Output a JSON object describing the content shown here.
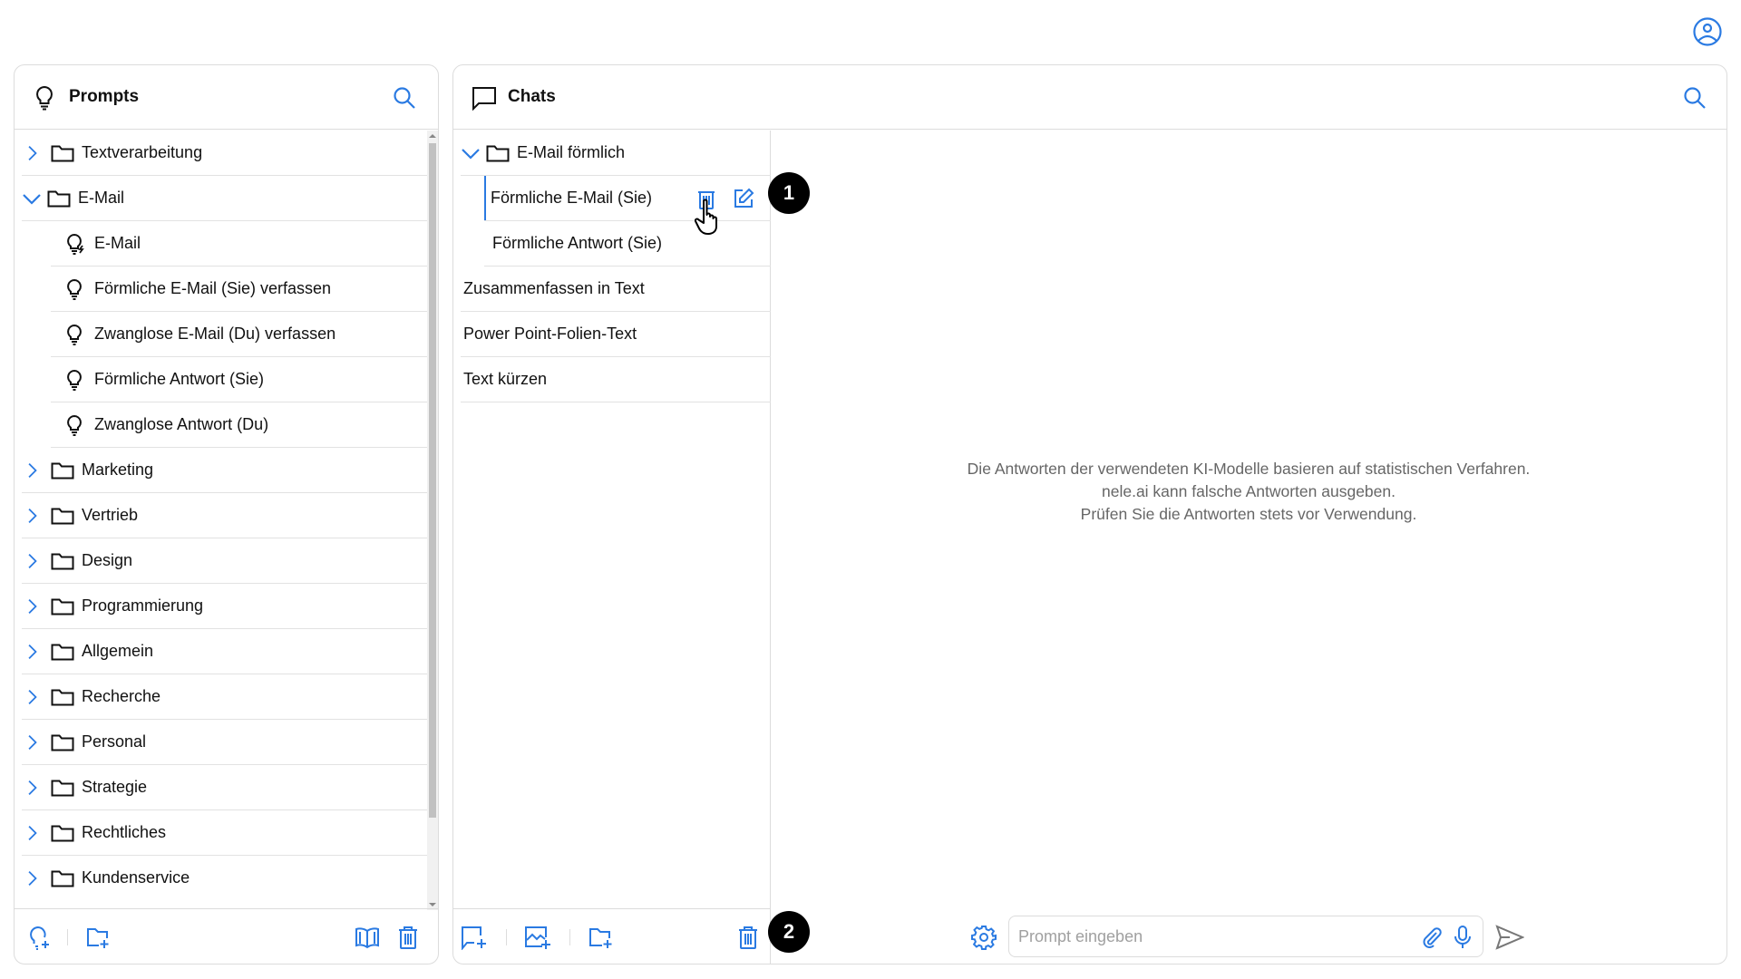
{
  "colors": {
    "accent": "#2a7ae2",
    "text": "#111111",
    "muted": "#666666",
    "border": "#dcdcdc"
  },
  "header": {
    "user_icon": "user-circle-icon"
  },
  "prompts": {
    "title": "Prompts",
    "items": [
      {
        "type": "folder",
        "label": "Textverarbeitung",
        "expanded": false
      },
      {
        "type": "folder",
        "label": "E-Mail",
        "expanded": true
      },
      {
        "type": "prompt",
        "label": "E-Mail",
        "icon": "bulb-bolt-icon"
      },
      {
        "type": "prompt",
        "label": "Förmliche E-Mail (Sie) verfassen",
        "icon": "bulb-icon"
      },
      {
        "type": "prompt",
        "label": "Zwanglose E-Mail (Du) verfassen",
        "icon": "bulb-icon"
      },
      {
        "type": "prompt",
        "label": "Förmliche Antwort (Sie)",
        "icon": "bulb-icon"
      },
      {
        "type": "prompt",
        "label": "Zwanglose Antwort (Du)",
        "icon": "bulb-icon"
      },
      {
        "type": "folder",
        "label": "Marketing",
        "expanded": false
      },
      {
        "type": "folder",
        "label": "Vertrieb",
        "expanded": false
      },
      {
        "type": "folder",
        "label": "Design",
        "expanded": false
      },
      {
        "type": "folder",
        "label": "Programmierung",
        "expanded": false
      },
      {
        "type": "folder",
        "label": "Allgemein",
        "expanded": false
      },
      {
        "type": "folder",
        "label": "Recherche",
        "expanded": false
      },
      {
        "type": "folder",
        "label": "Personal",
        "expanded": false
      },
      {
        "type": "folder",
        "label": "Strategie",
        "expanded": false
      },
      {
        "type": "folder",
        "label": "Rechtliches",
        "expanded": false
      },
      {
        "type": "folder",
        "label": "Kundenservice",
        "expanded": false
      }
    ],
    "footer_icons": [
      "new-prompt-icon",
      "new-folder-icon",
      "library-icon",
      "trash-icon"
    ]
  },
  "chats": {
    "title": "Chats",
    "folder": {
      "label": "E-Mail förmlich",
      "expanded": true
    },
    "folder_items": [
      {
        "label": "Förmliche E-Mail (Sie)",
        "active": true
      },
      {
        "label": "Förmliche Antwort (Sie)",
        "active": false
      }
    ],
    "items": [
      {
        "label": "Zusammenfassen in Text"
      },
      {
        "label": "Power Point-Folien-Text"
      },
      {
        "label": "Text kürzen"
      }
    ],
    "footer_icons": [
      "new-chat-icon",
      "new-image-chat-icon",
      "new-folder-icon",
      "trash-icon"
    ]
  },
  "main": {
    "disclaimer": [
      "Die Antworten der verwendeten KI-Modelle basieren auf statistischen Verfahren.",
      "nele.ai kann falsche Antworten ausgeben.",
      "Prüfen Sie die Antworten stets vor Verwendung."
    ],
    "input": {
      "value": "",
      "placeholder": "Prompt eingeben"
    }
  },
  "annotations": {
    "badge1": "1",
    "badge2": "2"
  }
}
